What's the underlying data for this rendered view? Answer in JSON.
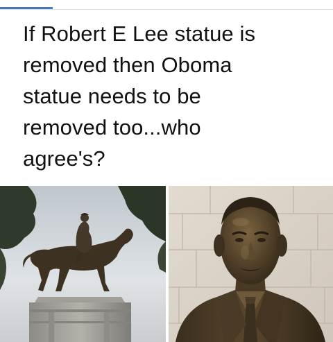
{
  "post": {
    "text_lines": [
      "If Robert E Lee statue is",
      "removed then Oboma",
      "statue needs to be",
      "removed too...who",
      "agree's?"
    ]
  },
  "colors": {
    "tab_indicator": "#4a78b8",
    "text": "#111111",
    "sky": "#cdd3d8",
    "bronze": "#4a3a26",
    "stone": "#9b9a94",
    "wall": "#d9d2c7"
  }
}
